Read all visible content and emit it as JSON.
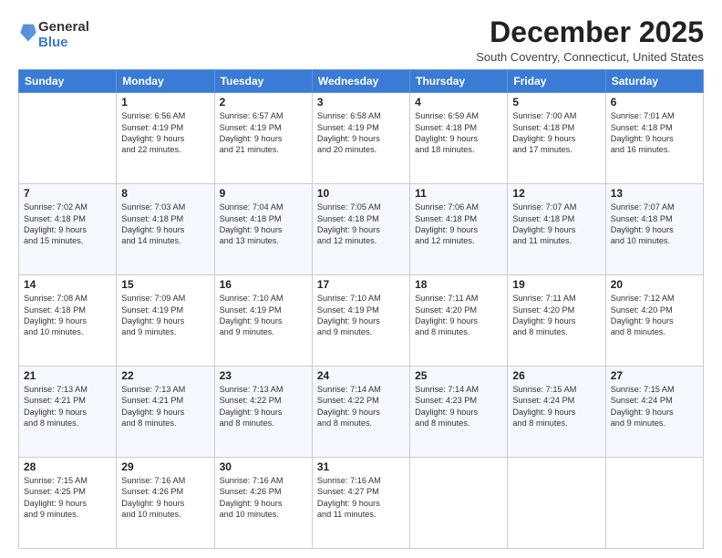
{
  "header": {
    "logo_general": "General",
    "logo_blue": "Blue",
    "month_title": "December 2025",
    "location": "South Coventry, Connecticut, United States"
  },
  "weekdays": [
    "Sunday",
    "Monday",
    "Tuesday",
    "Wednesday",
    "Thursday",
    "Friday",
    "Saturday"
  ],
  "weeks": [
    [
      {
        "day": "",
        "text": ""
      },
      {
        "day": "1",
        "text": "Sunrise: 6:56 AM\nSunset: 4:19 PM\nDaylight: 9 hours\nand 22 minutes."
      },
      {
        "day": "2",
        "text": "Sunrise: 6:57 AM\nSunset: 4:19 PM\nDaylight: 9 hours\nand 21 minutes."
      },
      {
        "day": "3",
        "text": "Sunrise: 6:58 AM\nSunset: 4:19 PM\nDaylight: 9 hours\nand 20 minutes."
      },
      {
        "day": "4",
        "text": "Sunrise: 6:59 AM\nSunset: 4:18 PM\nDaylight: 9 hours\nand 18 minutes."
      },
      {
        "day": "5",
        "text": "Sunrise: 7:00 AM\nSunset: 4:18 PM\nDaylight: 9 hours\nand 17 minutes."
      },
      {
        "day": "6",
        "text": "Sunrise: 7:01 AM\nSunset: 4:18 PM\nDaylight: 9 hours\nand 16 minutes."
      }
    ],
    [
      {
        "day": "7",
        "text": "Sunrise: 7:02 AM\nSunset: 4:18 PM\nDaylight: 9 hours\nand 15 minutes."
      },
      {
        "day": "8",
        "text": "Sunrise: 7:03 AM\nSunset: 4:18 PM\nDaylight: 9 hours\nand 14 minutes."
      },
      {
        "day": "9",
        "text": "Sunrise: 7:04 AM\nSunset: 4:18 PM\nDaylight: 9 hours\nand 13 minutes."
      },
      {
        "day": "10",
        "text": "Sunrise: 7:05 AM\nSunset: 4:18 PM\nDaylight: 9 hours\nand 12 minutes."
      },
      {
        "day": "11",
        "text": "Sunrise: 7:06 AM\nSunset: 4:18 PM\nDaylight: 9 hours\nand 12 minutes."
      },
      {
        "day": "12",
        "text": "Sunrise: 7:07 AM\nSunset: 4:18 PM\nDaylight: 9 hours\nand 11 minutes."
      },
      {
        "day": "13",
        "text": "Sunrise: 7:07 AM\nSunset: 4:18 PM\nDaylight: 9 hours\nand 10 minutes."
      }
    ],
    [
      {
        "day": "14",
        "text": "Sunrise: 7:08 AM\nSunset: 4:18 PM\nDaylight: 9 hours\nand 10 minutes."
      },
      {
        "day": "15",
        "text": "Sunrise: 7:09 AM\nSunset: 4:19 PM\nDaylight: 9 hours\nand 9 minutes."
      },
      {
        "day": "16",
        "text": "Sunrise: 7:10 AM\nSunset: 4:19 PM\nDaylight: 9 hours\nand 9 minutes."
      },
      {
        "day": "17",
        "text": "Sunrise: 7:10 AM\nSunset: 4:19 PM\nDaylight: 9 hours\nand 9 minutes."
      },
      {
        "day": "18",
        "text": "Sunrise: 7:11 AM\nSunset: 4:20 PM\nDaylight: 9 hours\nand 8 minutes."
      },
      {
        "day": "19",
        "text": "Sunrise: 7:11 AM\nSunset: 4:20 PM\nDaylight: 9 hours\nand 8 minutes."
      },
      {
        "day": "20",
        "text": "Sunrise: 7:12 AM\nSunset: 4:20 PM\nDaylight: 9 hours\nand 8 minutes."
      }
    ],
    [
      {
        "day": "21",
        "text": "Sunrise: 7:13 AM\nSunset: 4:21 PM\nDaylight: 9 hours\nand 8 minutes."
      },
      {
        "day": "22",
        "text": "Sunrise: 7:13 AM\nSunset: 4:21 PM\nDaylight: 9 hours\nand 8 minutes."
      },
      {
        "day": "23",
        "text": "Sunrise: 7:13 AM\nSunset: 4:22 PM\nDaylight: 9 hours\nand 8 minutes."
      },
      {
        "day": "24",
        "text": "Sunrise: 7:14 AM\nSunset: 4:22 PM\nDaylight: 9 hours\nand 8 minutes."
      },
      {
        "day": "25",
        "text": "Sunrise: 7:14 AM\nSunset: 4:23 PM\nDaylight: 9 hours\nand 8 minutes."
      },
      {
        "day": "26",
        "text": "Sunrise: 7:15 AM\nSunset: 4:24 PM\nDaylight: 9 hours\nand 8 minutes."
      },
      {
        "day": "27",
        "text": "Sunrise: 7:15 AM\nSunset: 4:24 PM\nDaylight: 9 hours\nand 9 minutes."
      }
    ],
    [
      {
        "day": "28",
        "text": "Sunrise: 7:15 AM\nSunset: 4:25 PM\nDaylight: 9 hours\nand 9 minutes."
      },
      {
        "day": "29",
        "text": "Sunrise: 7:16 AM\nSunset: 4:26 PM\nDaylight: 9 hours\nand 10 minutes."
      },
      {
        "day": "30",
        "text": "Sunrise: 7:16 AM\nSunset: 4:26 PM\nDaylight: 9 hours\nand 10 minutes."
      },
      {
        "day": "31",
        "text": "Sunrise: 7:16 AM\nSunset: 4:27 PM\nDaylight: 9 hours\nand 11 minutes."
      },
      {
        "day": "",
        "text": ""
      },
      {
        "day": "",
        "text": ""
      },
      {
        "day": "",
        "text": ""
      }
    ]
  ]
}
